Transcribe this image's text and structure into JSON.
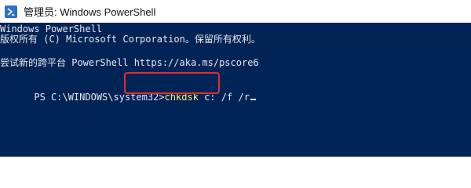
{
  "window": {
    "title": "管理员: Windows PowerShell",
    "icon": "powershell-icon",
    "accent_color": "#2b6fd0"
  },
  "terminal": {
    "background_color": "#012456",
    "text_color": "#e8e8e8",
    "command_color": "#fff46e",
    "highlight_color": "#e02c31",
    "lines": [
      "Windows PowerShell",
      "版权所有 (C) Microsoft Corporation。保留所有权利。",
      "尝试新的跨平台 PowerShell https://aka.ms/pscore6"
    ],
    "prompt": "PS C:\\WINDOWS\\system32>",
    "command_name": "chkdsk",
    "command_args": " c: /f /r"
  }
}
